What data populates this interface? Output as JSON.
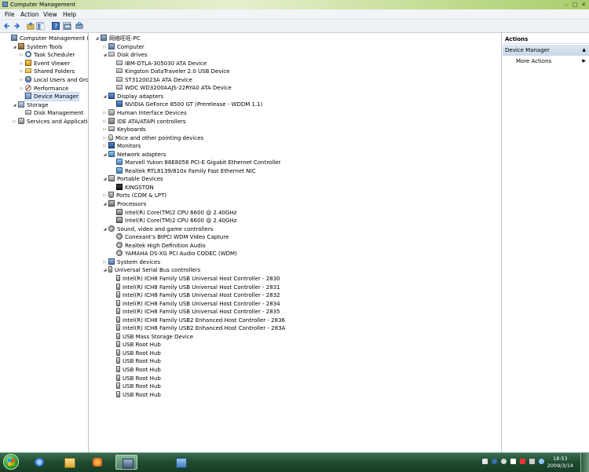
{
  "window": {
    "title": "Computer Management"
  },
  "menu": [
    "File",
    "Action",
    "View",
    "Help"
  ],
  "toolbar": [
    "back-icon",
    "forward-icon",
    "up-icon",
    "show-hide-tree-icon",
    "help-icon",
    "properties-icon",
    "scan-hardware-icon"
  ],
  "left_tree": [
    {
      "label": "Computer Management (Local",
      "indent": 0,
      "exp": "",
      "icon": "mgmt",
      "name": "tree-computer-management"
    },
    {
      "label": "System Tools",
      "indent": 1,
      "exp": "◢",
      "icon": "tool",
      "name": "tree-system-tools"
    },
    {
      "label": "Task Scheduler",
      "indent": 2,
      "exp": "▷",
      "icon": "clock",
      "name": "tree-task-scheduler"
    },
    {
      "label": "Event Viewer",
      "indent": 2,
      "exp": "▷",
      "icon": "event",
      "name": "tree-event-viewer"
    },
    {
      "label": "Shared Folders",
      "indent": 2,
      "exp": "▷",
      "icon": "folder",
      "name": "tree-shared-folders"
    },
    {
      "label": "Local Users and Groups",
      "indent": 2,
      "exp": "▷",
      "icon": "users",
      "name": "tree-local-users"
    },
    {
      "label": "Performance",
      "indent": 2,
      "exp": "▷",
      "icon": "perf",
      "name": "tree-performance"
    },
    {
      "label": "Device Manager",
      "indent": 2,
      "exp": "",
      "icon": "devmgr",
      "name": "tree-device-manager",
      "selected": true
    },
    {
      "label": "Storage",
      "indent": 1,
      "exp": "◢",
      "icon": "storage",
      "name": "tree-storage"
    },
    {
      "label": "Disk Management",
      "indent": 2,
      "exp": "",
      "icon": "disk",
      "name": "tree-disk-management"
    },
    {
      "label": "Services and Applications",
      "indent": 1,
      "exp": "▷",
      "icon": "svc",
      "name": "tree-services-applications"
    }
  ],
  "device_tree": [
    {
      "label": "网络旺旺-PC",
      "indent": 0,
      "exp": "◢",
      "icon": "comp"
    },
    {
      "label": "Computer",
      "indent": 1,
      "exp": "▷",
      "icon": "comp"
    },
    {
      "label": "Disk drives",
      "indent": 1,
      "exp": "◢",
      "icon": "disk"
    },
    {
      "label": "IBM-DTLA-305030 ATA Device",
      "indent": 2,
      "exp": "",
      "icon": "disk"
    },
    {
      "label": "Kingston DataTraveler 2.0 USB Device",
      "indent": 2,
      "exp": "",
      "icon": "disk"
    },
    {
      "label": "ST3120023A ATA Device",
      "indent": 2,
      "exp": "",
      "icon": "disk"
    },
    {
      "label": "WDC WD3200AAJS-22RYA0 ATA Device",
      "indent": 2,
      "exp": "",
      "icon": "disk"
    },
    {
      "label": "Display adapters",
      "indent": 1,
      "exp": "◢",
      "icon": "disp"
    },
    {
      "label": "NVIDIA GeForce 8500 GT (Prerelease - WDDM 1.1)",
      "indent": 2,
      "exp": "",
      "icon": "disp"
    },
    {
      "label": "Human Interface Devices",
      "indent": 1,
      "exp": "▷",
      "icon": "hid"
    },
    {
      "label": "IDE ATA/ATAPI controllers",
      "indent": 1,
      "exp": "▷",
      "icon": "ide"
    },
    {
      "label": "Keyboards",
      "indent": 1,
      "exp": "▷",
      "icon": "kb"
    },
    {
      "label": "Mice and other pointing devices",
      "indent": 1,
      "exp": "▷",
      "icon": "mouse"
    },
    {
      "label": "Monitors",
      "indent": 1,
      "exp": "▷",
      "icon": "mon"
    },
    {
      "label": "Network adapters",
      "indent": 1,
      "exp": "◢",
      "icon": "net"
    },
    {
      "label": "Marvell Yukon 88E8056 PCI-E Gigabit Ethernet Controller",
      "indent": 2,
      "exp": "",
      "icon": "net"
    },
    {
      "label": "Realtek RTL8139/810x Family Fast Ethernet NIC",
      "indent": 2,
      "exp": "",
      "icon": "net"
    },
    {
      "label": "Portable Devices",
      "indent": 1,
      "exp": "◢",
      "icon": "port"
    },
    {
      "label": "KINGSTON",
      "indent": 2,
      "exp": "",
      "icon": "port2"
    },
    {
      "label": "Ports (COM & LPT)",
      "indent": 1,
      "exp": "▷",
      "icon": "ports"
    },
    {
      "label": "Processors",
      "indent": 1,
      "exp": "◢",
      "icon": "cpu"
    },
    {
      "label": "Intel(R) Core(TM)2 CPU          6600  @ 2.40GHz",
      "indent": 2,
      "exp": "",
      "icon": "cpu"
    },
    {
      "label": "Intel(R) Core(TM)2 CPU          6600  @ 2.40GHz",
      "indent": 2,
      "exp": "",
      "icon": "cpu"
    },
    {
      "label": "Sound, video and game controllers",
      "indent": 1,
      "exp": "◢",
      "icon": "snd"
    },
    {
      "label": "Conexant's BtPCI WDM Video Capture",
      "indent": 2,
      "exp": "",
      "icon": "snd"
    },
    {
      "label": "Realtek High Definition Audio",
      "indent": 2,
      "exp": "",
      "icon": "snd"
    },
    {
      "label": "YAMAHA DS-XG PCI Audio CODEC (WDM)",
      "indent": 2,
      "exp": "",
      "icon": "snd"
    },
    {
      "label": "System devices",
      "indent": 1,
      "exp": "▷",
      "icon": "sys"
    },
    {
      "label": "Universal Serial Bus controllers",
      "indent": 1,
      "exp": "◢",
      "icon": "usb"
    },
    {
      "label": "Intel(R) ICH8 Family USB Universal Host Controller - 2830",
      "indent": 2,
      "exp": "",
      "icon": "usb"
    },
    {
      "label": "Intel(R) ICH8 Family USB Universal Host Controller - 2831",
      "indent": 2,
      "exp": "",
      "icon": "usb"
    },
    {
      "label": "Intel(R) ICH8 Family USB Universal Host Controller - 2832",
      "indent": 2,
      "exp": "",
      "icon": "usb"
    },
    {
      "label": "Intel(R) ICH8 Family USB Universal Host Controller - 2834",
      "indent": 2,
      "exp": "",
      "icon": "usb"
    },
    {
      "label": "Intel(R) ICH8 Family USB Universal Host Controller - 2835",
      "indent": 2,
      "exp": "",
      "icon": "usb"
    },
    {
      "label": "Intel(R) ICH8 Family USB2 Enhanced Host Controller - 2836",
      "indent": 2,
      "exp": "",
      "icon": "usb"
    },
    {
      "label": "Intel(R) ICH8 Family USB2 Enhanced Host Controller - 283A",
      "indent": 2,
      "exp": "",
      "icon": "usb"
    },
    {
      "label": "USB Mass Storage Device",
      "indent": 2,
      "exp": "",
      "icon": "usb"
    },
    {
      "label": "USB Root Hub",
      "indent": 2,
      "exp": "",
      "icon": "usb"
    },
    {
      "label": "USB Root Hub",
      "indent": 2,
      "exp": "",
      "icon": "usb"
    },
    {
      "label": "USB Root Hub",
      "indent": 2,
      "exp": "",
      "icon": "usb"
    },
    {
      "label": "USB Root Hub",
      "indent": 2,
      "exp": "",
      "icon": "usb"
    },
    {
      "label": "USB Root Hub",
      "indent": 2,
      "exp": "",
      "icon": "usb"
    },
    {
      "label": "USB Root Hub",
      "indent": 2,
      "exp": "",
      "icon": "usb"
    },
    {
      "label": "USB Root Hub",
      "indent": 2,
      "exp": "",
      "icon": "usb"
    }
  ],
  "actions": {
    "header": "Actions",
    "section": "Device Manager",
    "more": "More Actions"
  },
  "taskbar": {
    "clock_time": "18:53",
    "clock_date": "2009/3/14",
    "buttons": [
      "internet-explorer-icon",
      "windows-explorer-icon",
      "media-player-icon",
      "computer-management-icon",
      "network-icon"
    ]
  },
  "colors": {
    "selection": "#dce7f6",
    "taskbar": "#1f4b30",
    "accent": "#3e5673"
  }
}
